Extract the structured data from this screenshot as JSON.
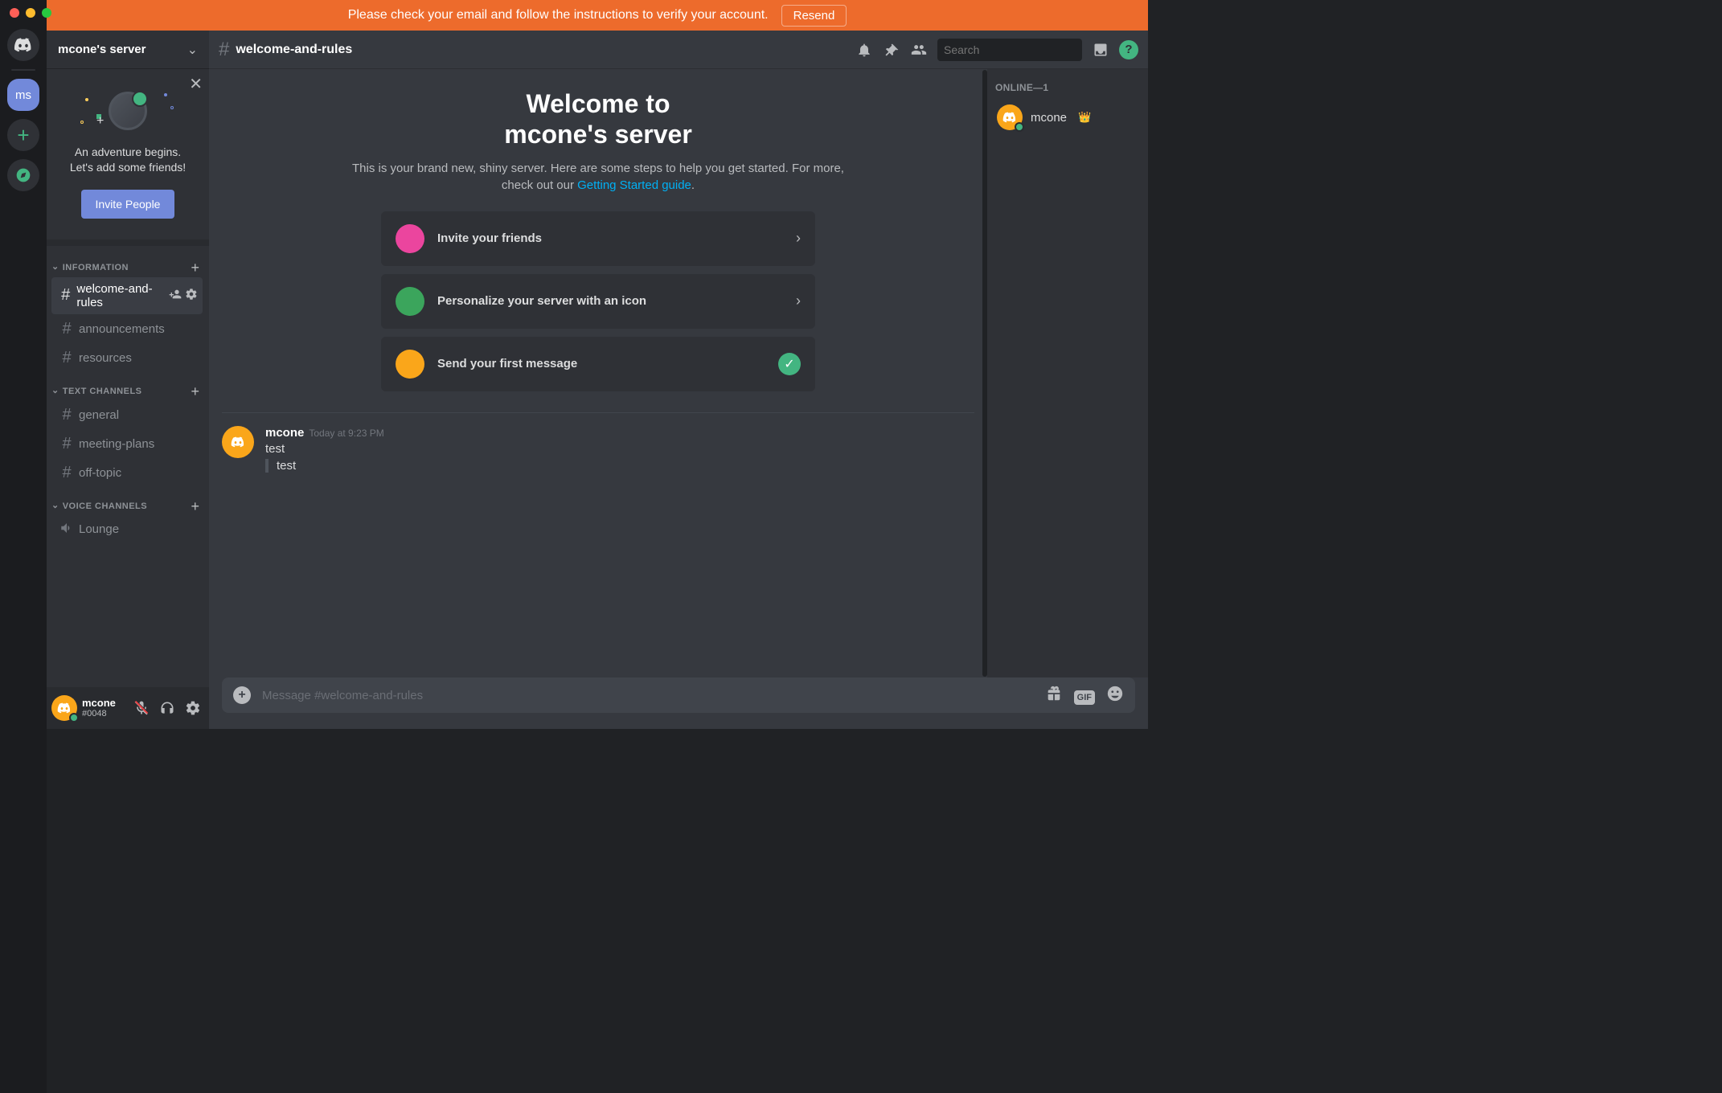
{
  "notice": {
    "text": "Please check your email and follow the instructions to verify your account.",
    "button": "Resend"
  },
  "rail": {
    "server_initials": "ms"
  },
  "sidebar": {
    "server_name": "mcone's server",
    "onboard_line1": "An adventure begins.",
    "onboard_line2": "Let's add some friends!",
    "invite_button": "Invite People",
    "categories": [
      {
        "label": "INFORMATION",
        "channels": [
          {
            "name": "welcome-and-rules",
            "type": "text",
            "active": true
          },
          {
            "name": "announcements",
            "type": "text",
            "active": false
          },
          {
            "name": "resources",
            "type": "text",
            "active": false
          }
        ]
      },
      {
        "label": "TEXT CHANNELS",
        "channels": [
          {
            "name": "general",
            "type": "text",
            "active": false
          },
          {
            "name": "meeting-plans",
            "type": "text",
            "active": false
          },
          {
            "name": "off-topic",
            "type": "text",
            "active": false
          }
        ]
      },
      {
        "label": "VOICE CHANNELS",
        "channels": [
          {
            "name": "Lounge",
            "type": "voice",
            "active": false
          }
        ]
      }
    ],
    "me": {
      "name": "mcone",
      "tag": "#0048"
    }
  },
  "topbar": {
    "channel": "welcome-and-rules",
    "search_placeholder": "Search"
  },
  "welcome": {
    "title_line1": "Welcome to",
    "title_line2": "mcone's server",
    "subtitle_pre": "This is your brand new, shiny server. Here are some steps to help you get started. For more, check out our ",
    "link_text": "Getting Started guide",
    "subtitle_post": ".",
    "cards": [
      {
        "label": "Invite your friends",
        "status": "arrow",
        "color": "#eb459e"
      },
      {
        "label": "Personalize your server with an icon",
        "status": "arrow",
        "color": "#3ba55c"
      },
      {
        "label": "Send your first message",
        "status": "done",
        "color": "#faa61a"
      }
    ]
  },
  "messages": [
    {
      "author": "mcone",
      "time": "Today at 9:23 PM",
      "text": "test",
      "quote": "test"
    }
  ],
  "composer": {
    "placeholder": "Message #welcome-and-rules"
  },
  "members": {
    "online_header": "ONLINE—1",
    "list": [
      {
        "name": "mcone",
        "owner": true
      }
    ]
  }
}
